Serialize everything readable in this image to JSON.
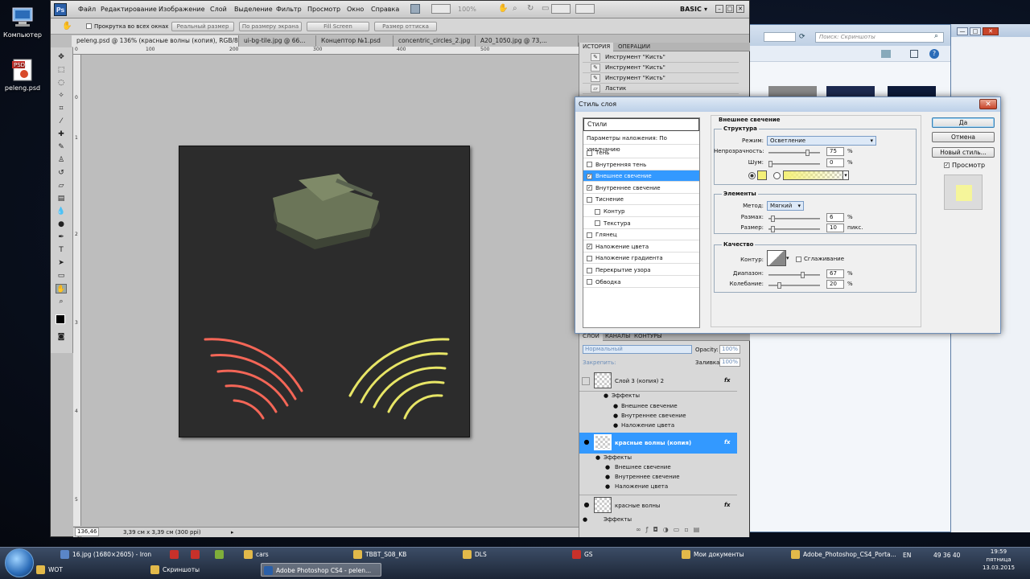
{
  "desktop": {
    "icons": [
      {
        "label": "Компьютер",
        "icon": "computer-icon"
      },
      {
        "label": "peleng.psd",
        "icon": "psd-file-icon"
      }
    ]
  },
  "photoshop": {
    "logo": "Ps",
    "menu": [
      "Файл",
      "Редактирование",
      "Изображение",
      "Слой",
      "Выделение",
      "Фильтр",
      "Просмотр",
      "Окно",
      "Справка"
    ],
    "zoom_display": "100%",
    "workspace": "BASIC",
    "options": {
      "scroll_all_label": "Прокрутка во всех окнах",
      "buttons": [
        "Реальный размер",
        "По размеру экрана",
        "Fill Screen",
        "Размер оттиска"
      ]
    },
    "tabs": [
      "peleng.psd @ 136% (красные волны (копия), RGB/8) *",
      "ui-bg-tile.jpg @ 66...",
      "Концептор №1.psd",
      "concentric_circles_2.jpg",
      "A20_1050.jpg @ 73,..."
    ],
    "ruler_top": [
      "0",
      "100",
      "200",
      "300",
      "400",
      "500",
      "600",
      "700",
      "800",
      "900",
      "1000"
    ],
    "ruler_left": [
      "0",
      "1",
      "2",
      "3",
      "4",
      "5",
      "6",
      "7",
      "8",
      "9"
    ],
    "status": {
      "zoom": "136,46 %",
      "doc_info": "3,39 см x 3,39 см (300 ppi)"
    }
  },
  "history_panel": {
    "tabs": [
      "ИСТОРИЯ",
      "ОПЕРАЦИИ"
    ],
    "items": [
      "Инструмент \"Кисть\"",
      "Инструмент \"Кисть\"",
      "Инструмент \"Кисть\"",
      "Ластик"
    ]
  },
  "layers_panel": {
    "tabs": [
      "СЛОИ",
      "КАНАЛЫ",
      "КОНТУРЫ"
    ],
    "blend_mode": "Нормальный",
    "opacity_label": "Opacity:",
    "opacity_value": "100%",
    "lock_label": "Закрепить:",
    "fill_label": "Заливка:",
    "fill_value": "100%",
    "layers": [
      {
        "name": "Слой 3 (копия) 2",
        "fx": "fx",
        "effects_label": "Эффекты",
        "effects": [
          "Внешнее свечение",
          "Внутреннее свечение",
          "Наложение цвета"
        ]
      },
      {
        "name": "красные волны (копия)",
        "fx": "fx",
        "effects_label": "Эффекты",
        "effects": [
          "Внешнее свечение",
          "Внутреннее свечение",
          "Наложение цвета"
        ]
      },
      {
        "name": "красные волны",
        "fx": "fx",
        "effects_label": "Эффекты",
        "effects": []
      }
    ]
  },
  "dialog": {
    "title": "Стиль слоя",
    "close": "✕",
    "styles_header": "Стили",
    "blend_options": "Параметры наложения: По умолчанию",
    "styles": [
      {
        "label": "Тень",
        "checked": false
      },
      {
        "label": "Внутренняя тень",
        "checked": false
      },
      {
        "label": "Внешнее свечение",
        "checked": true
      },
      {
        "label": "Внутреннее свечение",
        "checked": true
      },
      {
        "label": "Тиснение",
        "checked": false
      },
      {
        "label": "Контур",
        "checked": false
      },
      {
        "label": "Текстура",
        "checked": false
      },
      {
        "label": "Глянец",
        "checked": false
      },
      {
        "label": "Наложение цвета",
        "checked": true
      },
      {
        "label": "Наложение градиента",
        "checked": false
      },
      {
        "label": "Перекрытие узора",
        "checked": false
      },
      {
        "label": "Обводка",
        "checked": false
      }
    ],
    "section_title": "Внешнее свечение",
    "structure": {
      "title": "Структура",
      "mode_label": "Режим:",
      "mode_value": "Осветление",
      "opacity_label": "Непрозрачность:",
      "opacity_value": "75",
      "noise_label": "Шум:",
      "noise_value": "0",
      "pct": "%",
      "glow_color": "#f4f078"
    },
    "elements": {
      "title": "Элементы",
      "method_label": "Метод:",
      "method_value": "Мягкий",
      "spread_label": "Размах:",
      "spread_value": "6",
      "size_label": "Размер:",
      "size_value": "10",
      "size_unit": "пикс."
    },
    "quality": {
      "title": "Качество",
      "contour_label": "Контур:",
      "smooth_label": "Сглаживание",
      "range_label": "Диапазон:",
      "range_value": "67",
      "jitter_label": "Колебание:",
      "jitter_value": "20"
    },
    "buttons": {
      "ok": "Да",
      "cancel": "Отмена",
      "new_style": "Новый стиль..."
    },
    "preview_label": "Просмотр",
    "preview_color": "#f5f59a"
  },
  "explorer": {
    "search_placeholder": "Поиск: Скриншоты"
  },
  "taskbar": {
    "row1": [
      {
        "label": "16.jpg (1680×2605) - Iron",
        "color": "#5a86c8"
      },
      {
        "label": "",
        "color": "#c8312a"
      },
      {
        "label": "",
        "color": "#c8312a"
      },
      {
        "label": "",
        "color": "#7fae3a"
      },
      {
        "label": "cars",
        "color": "#e2b94a"
      },
      {
        "label": "TBBT_S08_KB",
        "color": "#e2b94a"
      },
      {
        "label": "DLS",
        "color": "#e2b94a"
      },
      {
        "label": "GS",
        "color": "#c8312a"
      },
      {
        "label": "Мои документы",
        "color": "#e2b94a"
      },
      {
        "label": "Adobe_Photoshop_CS4_Porta...",
        "color": "#e2b94a"
      }
    ],
    "row2": [
      {
        "label": "WOT",
        "color": "#e2b94a"
      },
      {
        "label": "Скриншоты",
        "color": "#e2b94a"
      },
      {
        "label": "Adobe Photoshop CS4 - pelen...",
        "color": "#2a5fa8",
        "active": true
      }
    ],
    "lang": "EN",
    "tray": "49 36 40",
    "time": "19:59",
    "day": "пятница",
    "date": "13.03.2015"
  }
}
